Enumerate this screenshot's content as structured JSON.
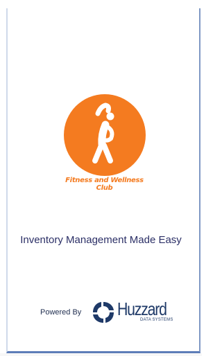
{
  "brand": {
    "line1": "Fitness and Wellness",
    "line2": "Club",
    "color": "#f47b20",
    "icon": "stretching-person-icon"
  },
  "tagline": "Inventory Management Made Easy",
  "footer": {
    "powered_by": "Powered By",
    "company": "Huzzard",
    "company_sub": "DATA SYSTEMS",
    "company_icon": "huzzard-swirl-icon",
    "company_color": "#1f3a68"
  }
}
